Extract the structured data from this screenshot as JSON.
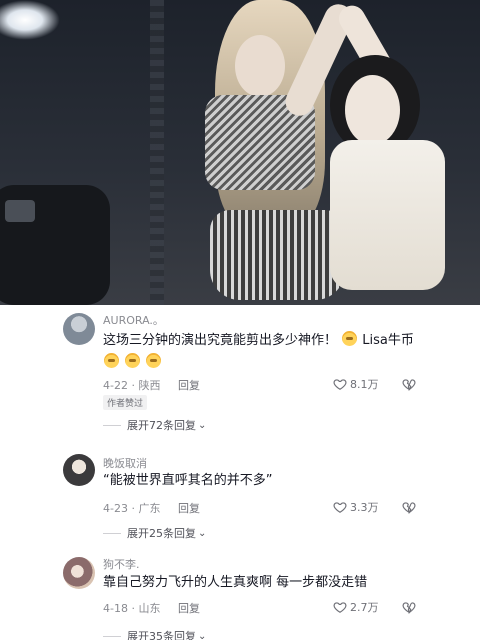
{
  "comments": [
    {
      "username": "AURORA.。",
      "text": "这场三分钟的演出究竟能剪出多少神作！",
      "text_tail": "Lisa牛币",
      "emoji_count": 4,
      "date": "4-22",
      "location": "陕西",
      "reply_label": "回复",
      "likes": "8.1万",
      "badge": "作者赞过",
      "expand": "展开72条回复"
    },
    {
      "username": "晚饭取消",
      "text": "“能被世界直呼其名的并不多”",
      "date": "4-23",
      "location": "广东",
      "reply_label": "回复",
      "likes": "3.3万",
      "expand": "展开25条回复"
    },
    {
      "username": "狗不李.",
      "text": "靠自己努力飞升的人生真爽啊 每一步都没走错",
      "date": "4-18",
      "location": "山东",
      "reply_label": "回复",
      "likes": "2.7万",
      "expand": "展开35条回复"
    }
  ],
  "icons": {
    "like": "heart-outline-icon",
    "dislike": "broken-heart-icon",
    "expand": "chevron-down-icon"
  }
}
